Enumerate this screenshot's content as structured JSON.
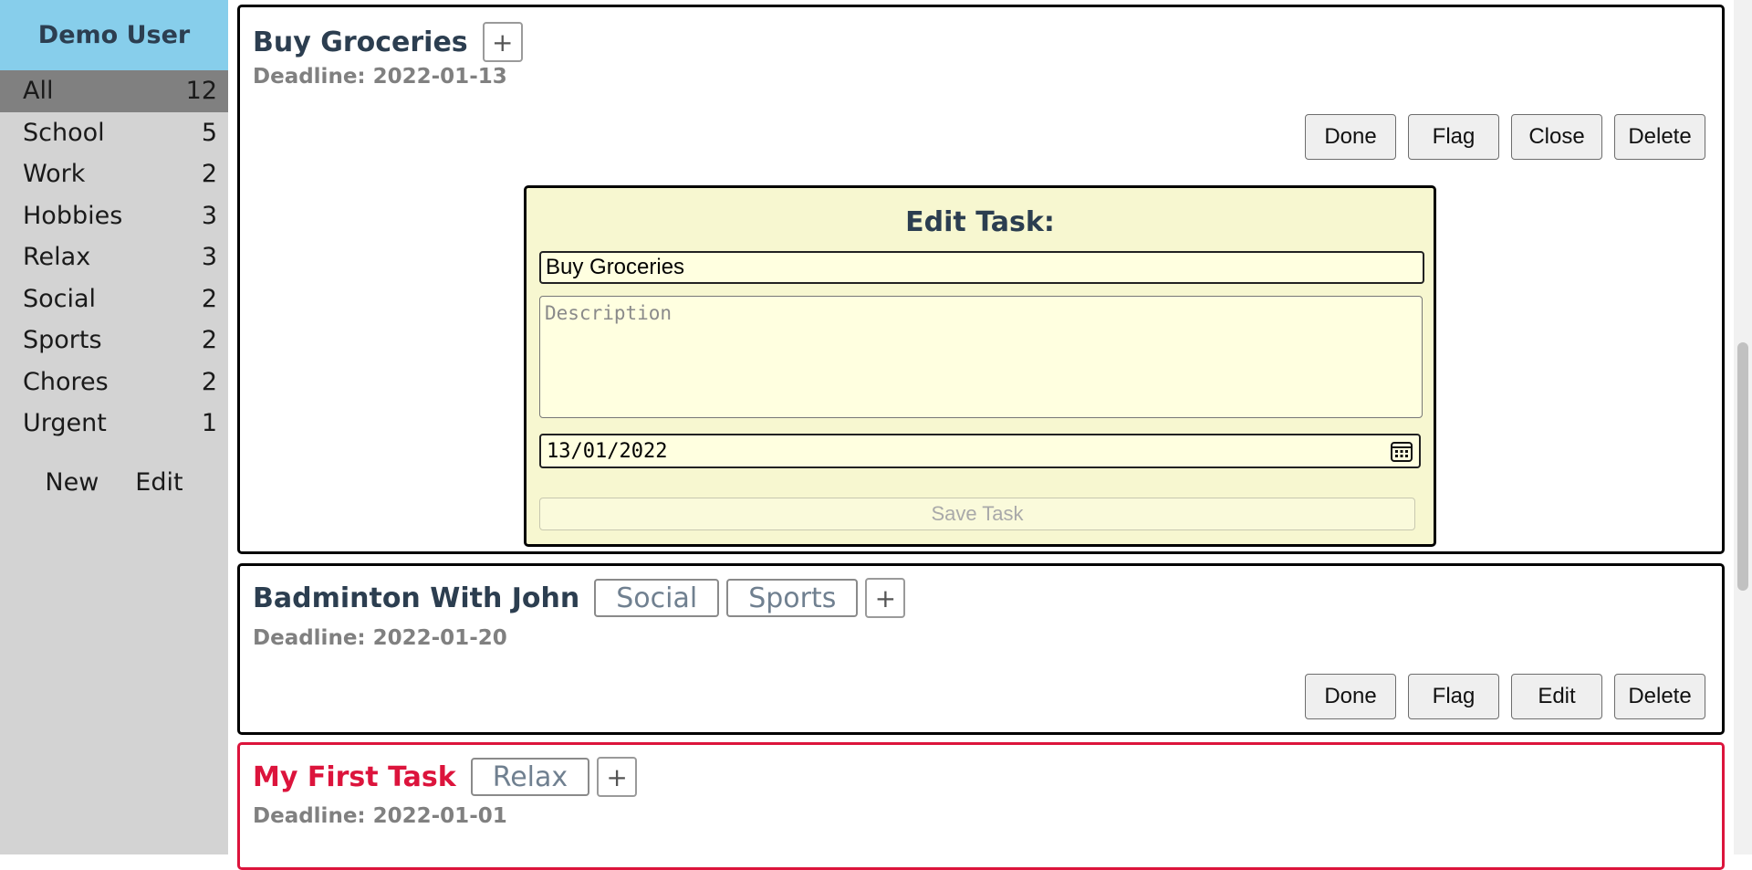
{
  "user": {
    "name": "Demo User"
  },
  "categories": [
    {
      "label": "All",
      "count": "12",
      "active": true
    },
    {
      "label": "School",
      "count": "5"
    },
    {
      "label": "Work",
      "count": "2"
    },
    {
      "label": "Hobbies",
      "count": "3"
    },
    {
      "label": "Relax",
      "count": "3"
    },
    {
      "label": "Social",
      "count": "2"
    },
    {
      "label": "Sports",
      "count": "2"
    },
    {
      "label": "Chores",
      "count": "2"
    },
    {
      "label": "Urgent",
      "count": "1"
    }
  ],
  "sidebar_actions": {
    "new_label": "New",
    "edit_label": "Edit"
  },
  "tasks": [
    {
      "title": "Buy Groceries",
      "deadline": "Deadline: 2022-01-13",
      "add_tag": "+",
      "buttons": {
        "done": "Done",
        "flag": "Flag",
        "toggle": "Close",
        "delete": "Delete"
      }
    },
    {
      "title": "Badminton With John",
      "tags": [
        "Social",
        "Sports"
      ],
      "deadline": "Deadline: 2022-01-20",
      "add_tag": "+",
      "buttons": {
        "done": "Done",
        "flag": "Flag",
        "toggle": "Edit",
        "delete": "Delete"
      }
    },
    {
      "title": "My First Task",
      "tags": [
        "Relax"
      ],
      "deadline": "Deadline: 2022-01-01",
      "add_tag": "+",
      "urgent": true
    }
  ],
  "edit_form": {
    "heading": "Edit Task:",
    "title_value": "Buy Groceries",
    "description_placeholder": "Description",
    "date_value": "13/01/2022",
    "save_label": "Save Task"
  },
  "colors": {
    "sidebar_header": "#87ceeb",
    "sidebar_bg": "#d3d3d3",
    "active_category": "#808080",
    "title_text": "#2c3e50",
    "urgent": "#dc143c",
    "edit_panel_bg": "#f7f7d0"
  }
}
